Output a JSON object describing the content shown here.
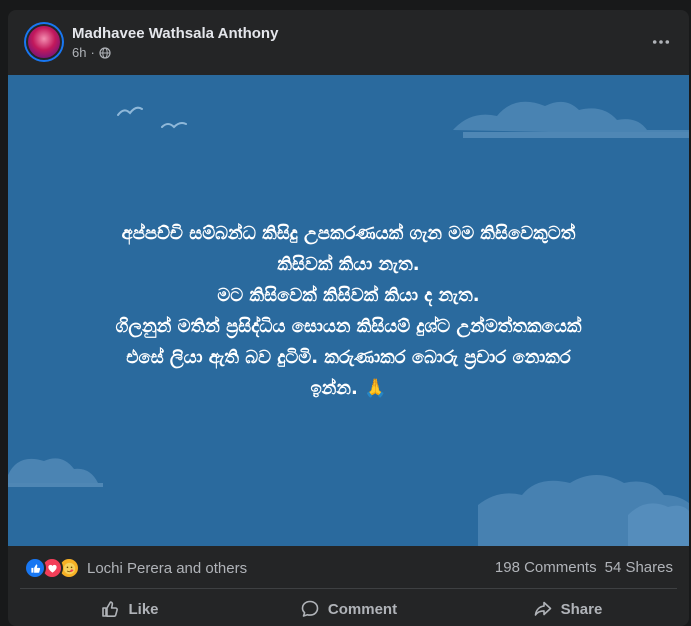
{
  "post": {
    "author": "Madhavee Wathsala Anthony",
    "time": "6h",
    "separator": "·",
    "background_color": "#2a6a9e",
    "lines": [
      "අප්පච්චි සම්බන්ධ කිසිදු උපකරණයක් ගැන මම කිසිවෙකුටත්",
      "කිසිවක් කියා නැත.",
      "මට කිසිවෙක් කිසිවක් කියා ද නැත.",
      "ගිලනුන් මතින් ප්‍රසිද්ධිය සොයන කිසියම් දුශ්ට උන්මත්තකයෙක්",
      "එසේ ලියා ඇති බව දුටිමි. කරුණාකර බොරු ප්‍රචාර නොකර",
      "ඉන්න. 🙏"
    ]
  },
  "stats": {
    "reaction_names": "Lochi Perera and others",
    "comments": "198 Comments",
    "shares": "54 Shares",
    "reaction_icons": [
      "like-icon",
      "love-icon",
      "care-icon"
    ]
  },
  "actions": {
    "like": "Like",
    "comment": "Comment",
    "share": "Share"
  }
}
